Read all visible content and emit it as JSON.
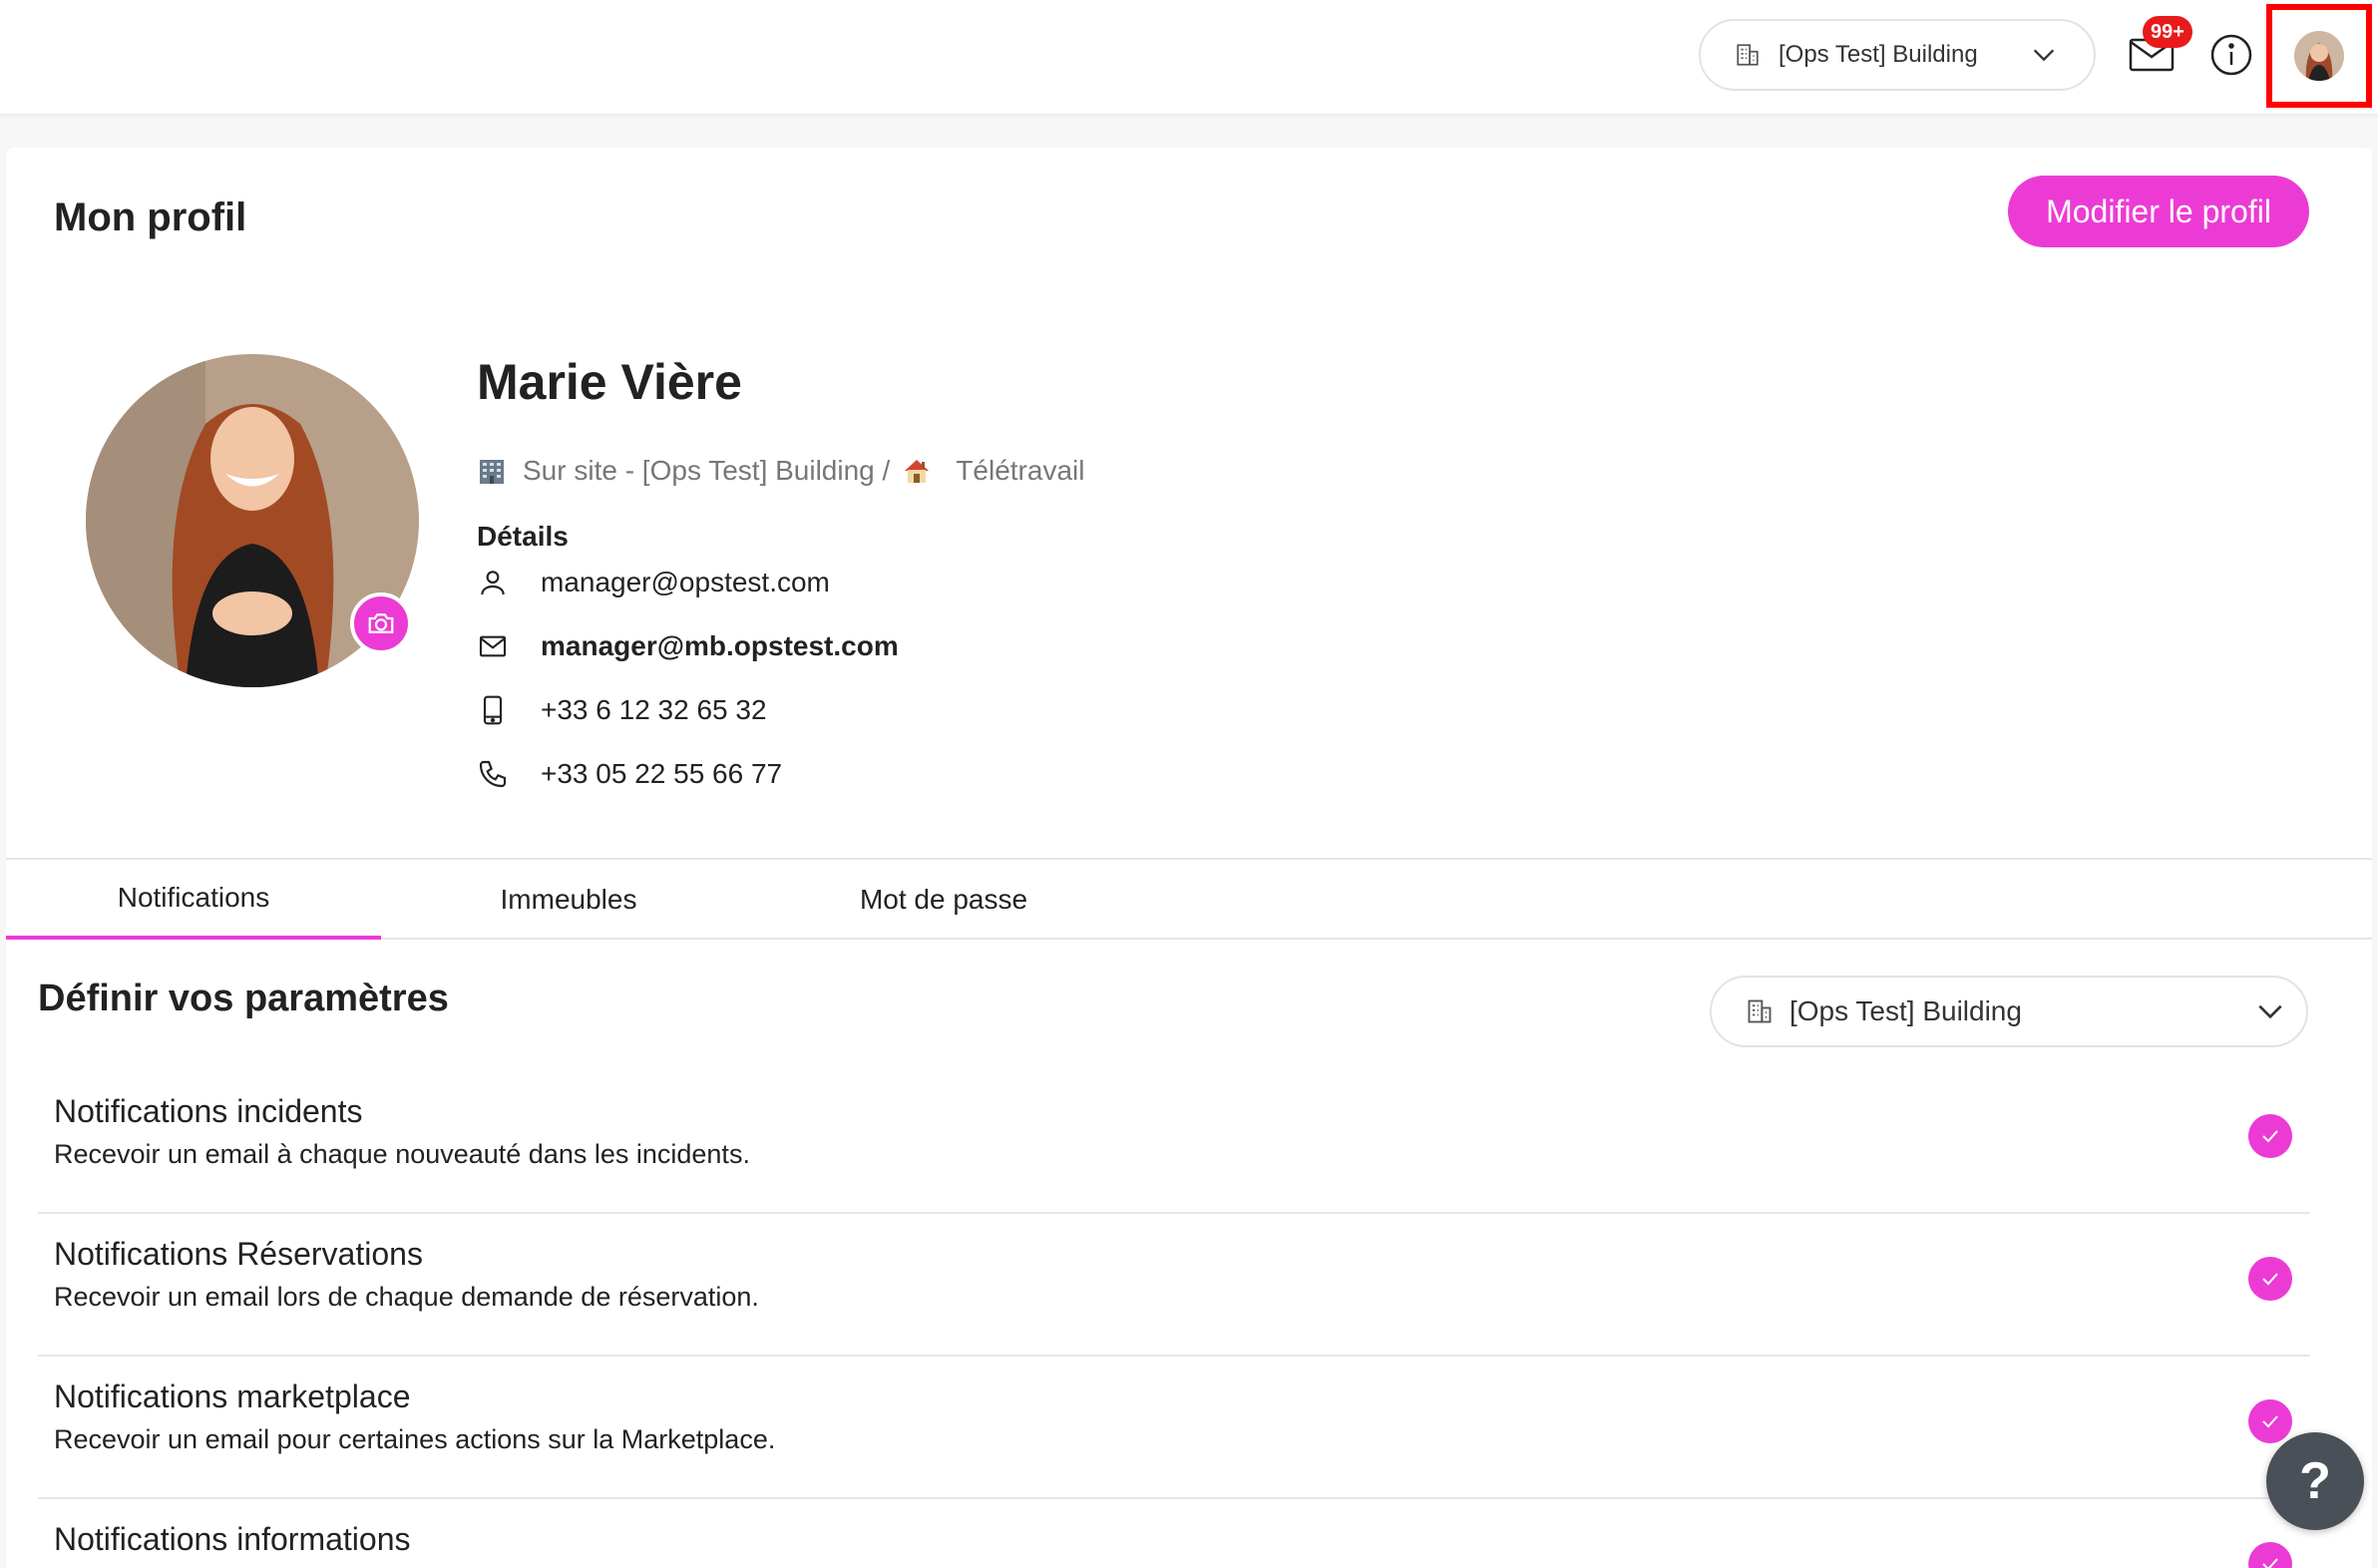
{
  "topbar": {
    "building_select": "[Ops Test] Building",
    "mail_badge": "99+",
    "icons": [
      "building-icon",
      "chevron-down-icon",
      "mail-icon",
      "info-icon",
      "avatar"
    ]
  },
  "header": {
    "title": "Mon profil",
    "edit_button": "Modifier le profil"
  },
  "profile": {
    "name": "Marie Vière",
    "location_onsite": "Sur site - [Ops Test] Building /",
    "location_remote": "Télétravail",
    "details_title": "Détails",
    "login_email": "manager@opstest.com",
    "email": "manager@mb.opstest.com",
    "mobile": "+33 6 12 32 65 32",
    "phone": "+33 05 22 55 66 77"
  },
  "tabs": [
    {
      "label": "Notifications",
      "active": true
    },
    {
      "label": "Immeubles",
      "active": false
    },
    {
      "label": "Mot de passe",
      "active": false
    }
  ],
  "settings": {
    "title": "Définir vos paramètres",
    "building_select": "[Ops Test] Building",
    "items": [
      {
        "title": "Notifications incidents",
        "desc": "Recevoir un email à chaque nouveauté dans les incidents.",
        "checked": true
      },
      {
        "title": "Notifications Réservations",
        "desc": "Recevoir un email lors de chaque demande de réservation.",
        "checked": true
      },
      {
        "title": "Notifications marketplace",
        "desc": "Recevoir un email pour certaines actions sur la Marketplace.",
        "checked": true
      },
      {
        "title": "Notifications informations",
        "desc": "",
        "checked": true
      }
    ]
  },
  "help_button": "?",
  "colors": {
    "accent": "#ec3bd4",
    "badge": "#e81a1a",
    "help": "#4a5057"
  }
}
